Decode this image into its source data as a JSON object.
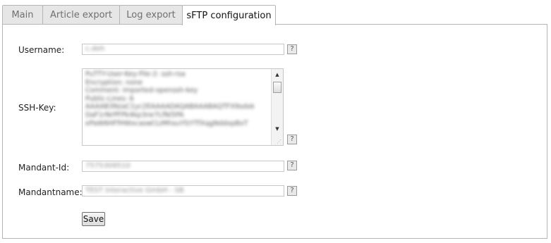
{
  "tabs": [
    {
      "label": "Main",
      "active": false
    },
    {
      "label": "Article export",
      "active": false
    },
    {
      "label": "Log export",
      "active": false
    },
    {
      "label": "sFTP configuration",
      "active": true
    }
  ],
  "form": {
    "username": {
      "label": "Username:",
      "value": "c.deh"
    },
    "ssh_key": {
      "label": "SSH-Key:",
      "lines": [
        "PuTTY-User-Key-File-2: ssh-rsa",
        "Encryption: none",
        "Comment: imported-openssh-key",
        "Public-Lines: 6",
        "AAAAB3NzaC1yc2EAAAADAQABAAABAQTFX9sdxk",
        "DaF1rNrPFPk4kp3ne7LfNi5PA",
        "ePaW6HFfHWxcaswt1zMhsuYfzYTfXqgNddxpBxT"
      ]
    },
    "mandant_id": {
      "label": "Mandant-Id:",
      "value": "7575309510"
    },
    "mandantname": {
      "label": "Mandantname:",
      "value": "TEST Interactive GmbH - SB"
    },
    "help_symbol": "?",
    "save_label": "Save"
  }
}
